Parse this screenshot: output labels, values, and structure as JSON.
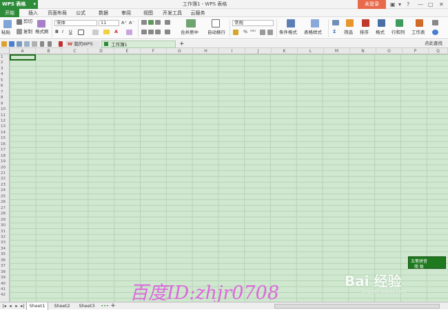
{
  "titlebar": {
    "app_label": "WPS 表格",
    "app_caret": "▾",
    "doc_title": "工作簿1 - WPS 表格",
    "login_label": "未登录",
    "controls": [
      "▣",
      "▾",
      "?",
      "—",
      "▢",
      "✕"
    ]
  },
  "menu": [
    "开始",
    "插入",
    "页面布局",
    "公式",
    "数据",
    "审阅",
    "视图",
    "开发工具",
    "云服务"
  ],
  "ribbon": {
    "paste": "粘贴",
    "cut": "剪切",
    "copy": "复制",
    "format_painter": "格式刷",
    "font_name": "宋体",
    "font_size": "11",
    "grow": "A⁺",
    "shrink": "A⁻",
    "bold": "B",
    "italic": "I",
    "underline": "U",
    "font_color": "A",
    "merge": "合并居中",
    "wrap": "自动换行",
    "number_format": "常规",
    "percent": "%",
    "thousands": "⁰⁰⁰",
    "cond_format": "条件格式",
    "table_style": "表格样式",
    "sum": "Σ",
    "filter": "筛选",
    "sort": "排序",
    "format": "格式",
    "rowcol": "行和列",
    "worksheet": "工作表",
    "find": "点此查找"
  },
  "tabs": {
    "home": "我的WPS",
    "doc": "工作簿1",
    "add": "+"
  },
  "columns": [
    "A",
    "B",
    "C",
    "D",
    "E",
    "F",
    "G",
    "H",
    "I",
    "J",
    "K",
    "L",
    "M",
    "N",
    "O",
    "P",
    "Q"
  ],
  "rows": [
    "1",
    "2",
    "3",
    "4",
    "5",
    "6",
    "7",
    "8",
    "9",
    "10",
    "11",
    "12",
    "13",
    "14",
    "15",
    "16",
    "17",
    "18",
    "19",
    "20",
    "21",
    "22",
    "23",
    "24",
    "25",
    "26",
    "27",
    "28",
    "29",
    "30",
    "31",
    "32",
    "33",
    "34",
    "35",
    "36",
    "37",
    "38",
    "39",
    "40",
    "41",
    "42"
  ],
  "sheets": [
    "Sheet1",
    "Sheet2",
    "Sheet3"
  ],
  "sheet_more": "•••",
  "sheet_add": "+",
  "float_panel": {
    "line1": "五笔拼音",
    "line2": "简 致"
  },
  "watermark": "百度ID:zhjr0708",
  "baidu_logo": "Bai 经验",
  "baidu_sub": "jingyan.baidu.com",
  "colors": {
    "brand": "#2e8b3a",
    "grid_bg": "#cfe8cf",
    "login": "#e86a4a",
    "watermark": "#e05be0"
  }
}
